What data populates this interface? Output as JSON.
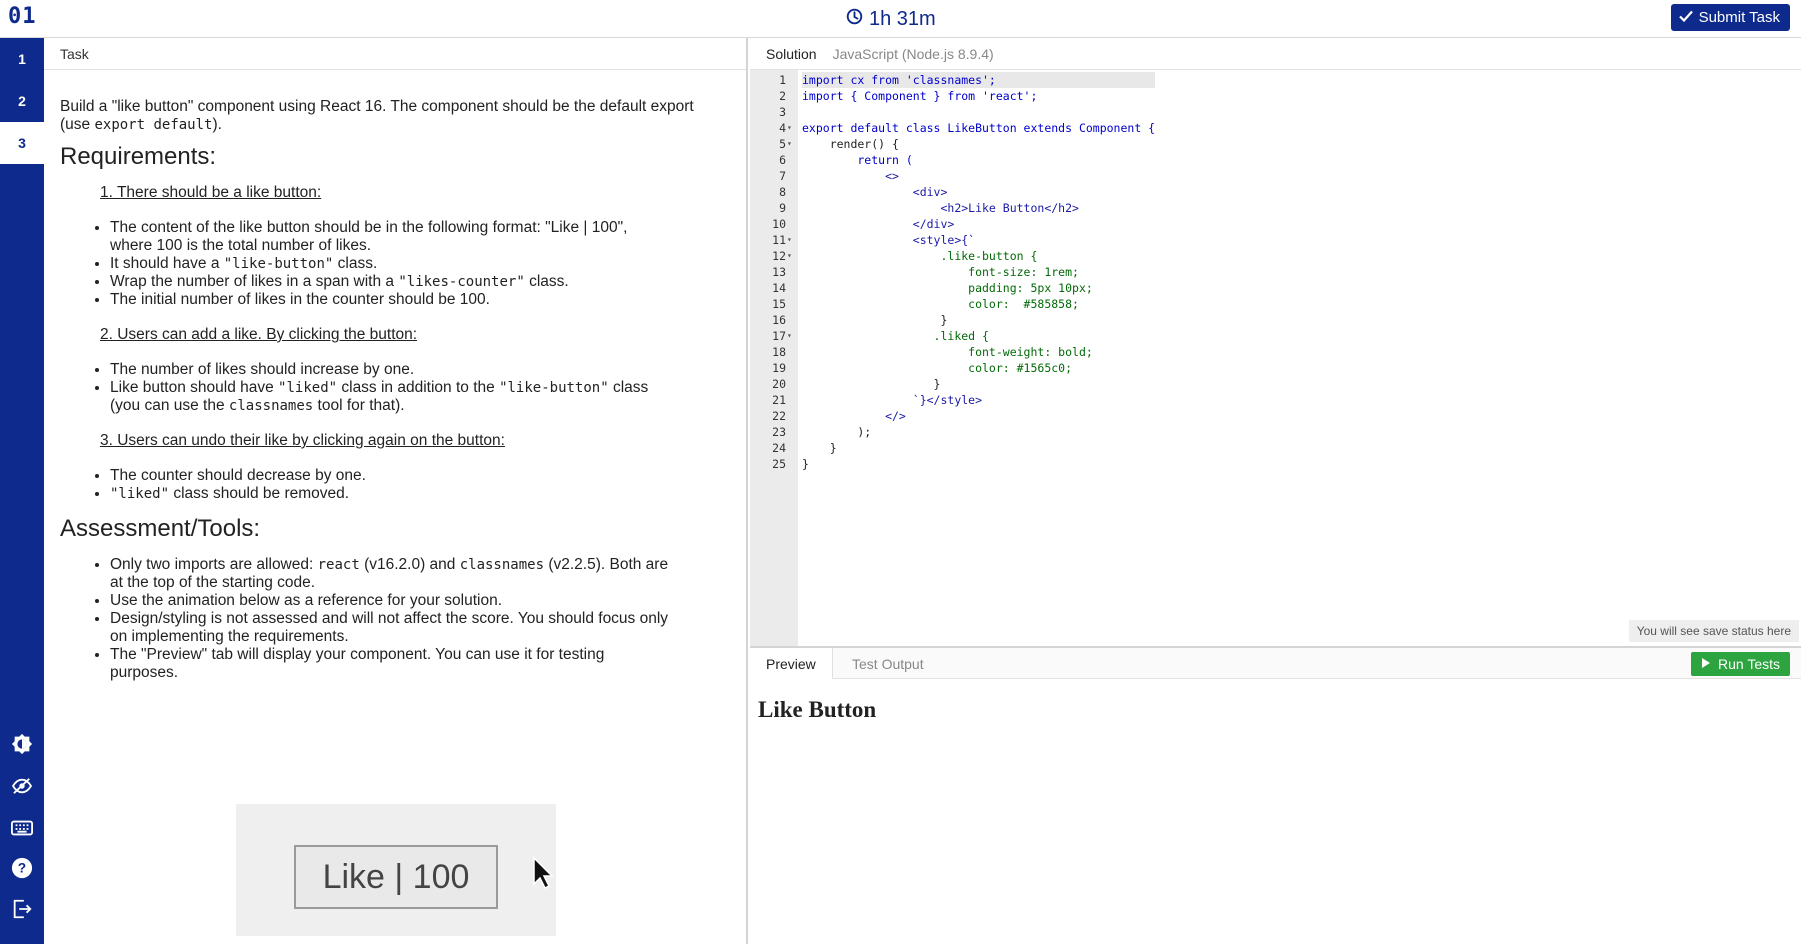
{
  "topbar": {
    "logo": "01",
    "timer": "1h 31m",
    "submit_label": "Submit Task"
  },
  "leftnav": {
    "items": [
      "1",
      "2",
      "3"
    ],
    "active": "3",
    "icons": [
      "theme-contrast-icon",
      "eye-slash-icon",
      "keyboard-icon",
      "help-icon",
      "exit-icon"
    ]
  },
  "task": {
    "header": "Task",
    "intro_pre": "Build a \"like button\" component using React 16. The component should be the default export (use ",
    "intro_code": "export default",
    "intro_post": ").",
    "requirements_heading": "Requirements:",
    "req1_title": "1. There should be a like button:",
    "req1_items": [
      "The content of the like button should be in the following format: \"Like | 100\", where 100 is the total number of likes.",
      "It should have a \"like-button\" class.",
      "Wrap the number of likes in a span with a \"likes-counter\" class.",
      "The initial number of likes in the counter should be 100."
    ],
    "req2_title": "2. Users can add a like. By clicking the button:",
    "req2_items": [
      "The number of likes should increase by one.",
      "Like button should have \"liked\" class in addition to the \"like-button\" class (you can use the classnames tool for that)."
    ],
    "req3_title": "3. Users can undo their like by clicking again on the button:",
    "req3_items": [
      "The counter should decrease by one.",
      "\"liked\" class should be removed."
    ],
    "assessment_heading": "Assessment/Tools:",
    "assessment_items": [
      "Only two imports are allowed: react (v16.2.0) and classnames (v2.2.5). Both are at the top of the starting code.",
      "Use the animation below as a reference for your solution.",
      "Design/styling is not assessed and will not affect the score. You should focus only on implementing the requirements.",
      "The \"Preview\" tab will display your component. You can use it for testing purposes."
    ],
    "animation_button": "Like | 100"
  },
  "solution": {
    "header": "Solution",
    "language": "JavaScript (Node.js 8.9.4)",
    "save_status": "You will see save status here",
    "code_lines": [
      "import cx from 'classnames';",
      "import { Component } from 'react';",
      "",
      "export default class LikeButton extends Component {",
      "    render() {",
      "        return (",
      "            <>",
      "                <div>",
      "                    <h2>Like Button</h2>",
      "                </div>",
      "                <style>{`",
      "                    .like-button {",
      "                        font-size: 1rem;",
      "                        padding: 5px 10px;",
      "                        color:  #585858;",
      "                    }",
      "                   .liked {",
      "                        font-weight: bold;",
      "                        color: #1565c0;",
      "                   }",
      "                `}</style>",
      "            </>",
      "        );",
      "    }",
      "}"
    ]
  },
  "preview": {
    "tabs": [
      "Preview",
      "Test Output"
    ],
    "active_tab": "Preview",
    "run_label": "Run Tests",
    "content_heading": "Like Button"
  },
  "colors": {
    "brand": "#0d2a8c",
    "run_green": "#2da440"
  }
}
